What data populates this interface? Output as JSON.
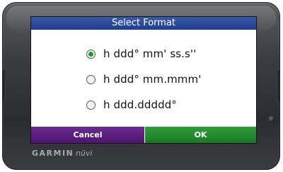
{
  "device": {
    "brand": "GARMIN",
    "model": "nüvi"
  },
  "dialog": {
    "title": "Select Format",
    "options": [
      {
        "label": "h ddd° mm' ss.s''",
        "selected": true
      },
      {
        "label": "h ddd° mm.mmm'",
        "selected": false
      },
      {
        "label": "h ddd.ddddd°",
        "selected": false
      }
    ],
    "cancel_label": "Cancel",
    "ok_label": "OK"
  },
  "colors": {
    "title_bar": "#1d3f8c",
    "cancel": "#4e1570",
    "ok": "#1b7a25",
    "radio_selected": "#1f9a2b"
  }
}
